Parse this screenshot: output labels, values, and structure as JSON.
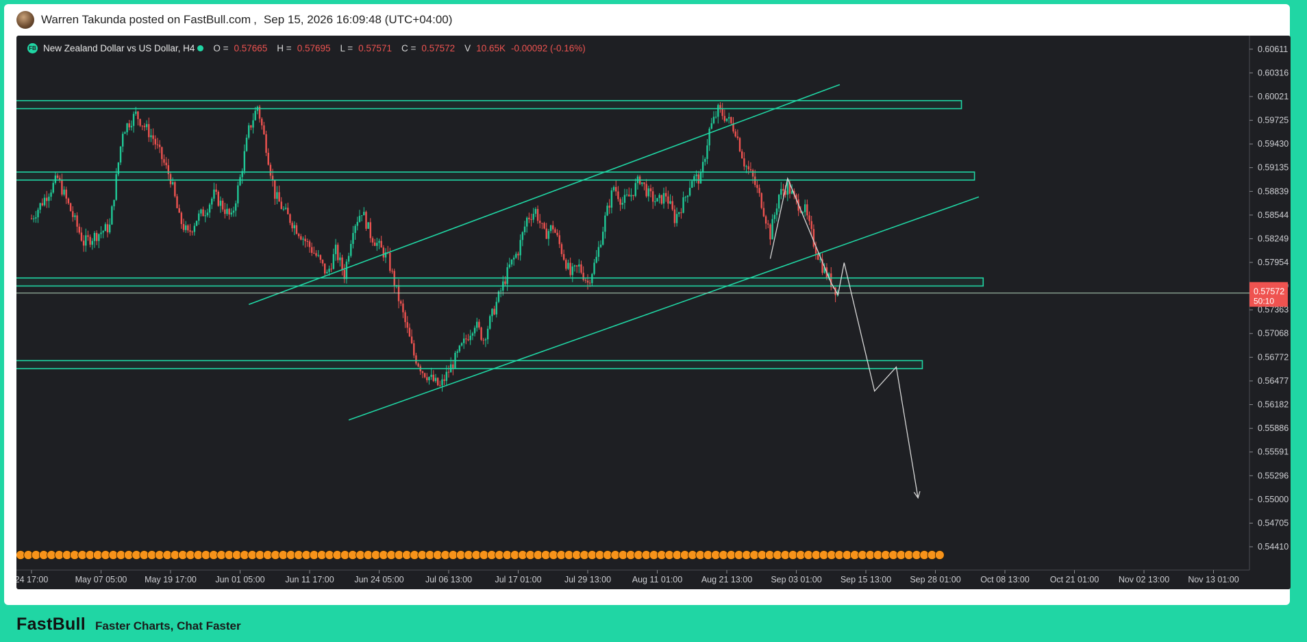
{
  "post": {
    "author_line": "Warren Takunda posted on FastBull.com",
    "separator": ",",
    "timestamp": "Sep 15, 2026 16:09:48 (UTC+04:00)"
  },
  "instrument": {
    "badge": "FB",
    "name": "New Zealand Dollar vs US Dollar, H4",
    "open_label": "O =",
    "open": "0.57665",
    "high_label": "H =",
    "high": "0.57695",
    "low_label": "L =",
    "low": "0.57571",
    "close_label": "C =",
    "close": "0.57572",
    "volume_label": "V",
    "volume": "10.65K",
    "change": "-0.00092 (-0.16%)"
  },
  "price_tag": {
    "price": "0.57572",
    "countdown": "50:10",
    "color": "#ef5350"
  },
  "footer": {
    "brand": "FastBull",
    "tagline": "Faster Charts, Chat Faster"
  },
  "colors": {
    "up": "#20c997",
    "down": "#ef5350",
    "drawing": "#20d6a4",
    "projection": "#d8d8d8",
    "event_marker": "#f7931a",
    "background": "#1e1f23"
  },
  "chart_data": {
    "type": "line",
    "subtype": "candlestick",
    "title": "",
    "xlabel": "",
    "ylabel": "",
    "ylim": [
      0.5412,
      0.6078
    ],
    "grid": false,
    "y_ticks": [
      "0.60611",
      "0.60316",
      "0.60021",
      "0.59725",
      "0.59430",
      "0.59135",
      "0.58839",
      "0.58544",
      "0.58249",
      "0.57954",
      "0.57659",
      "0.57363",
      "0.57068",
      "0.56772",
      "0.56477",
      "0.56182",
      "0.55886",
      "0.55591",
      "0.55296",
      "0.55000",
      "0.54705",
      "0.54410"
    ],
    "x_ticks": [
      "24 17:00",
      "May 07 05:00",
      "May 19 17:00",
      "Jun 01 05:00",
      "Jun 11 17:00",
      "Jun 24 05:00",
      "Jul 06 13:00",
      "Jul 17 01:00",
      "Jul 29 13:00",
      "Aug 11 01:00",
      "Aug 21 13:00",
      "Sep 03 01:00",
      "Sep 15 13:00",
      "Sep 28 01:00",
      "Oct 08 13:00",
      "Oct 21 01:00",
      "Nov 02 13:00",
      "Nov 13 01:00"
    ],
    "series": [
      {
        "values": [
          [
            0,
            0.585
          ],
          [
            3,
            0.59
          ],
          [
            6,
            0.582
          ],
          [
            9,
            0.584
          ],
          [
            10.5,
            0.596
          ],
          [
            12,
            0.598
          ],
          [
            14,
            0.595
          ],
          [
            16,
            0.59
          ],
          [
            17,
            0.585
          ],
          [
            18,
            0.583
          ],
          [
            19,
            0.585
          ],
          [
            20,
            0.586
          ],
          [
            21,
            0.588
          ],
          [
            23,
            0.585
          ],
          [
            24,
            0.59
          ],
          [
            25,
            0.596
          ],
          [
            26,
            0.599
          ],
          [
            27,
            0.594
          ],
          [
            28,
            0.588
          ],
          [
            29,
            0.586
          ],
          [
            31,
            0.583
          ],
          [
            33,
            0.58
          ],
          [
            34,
            0.578
          ],
          [
            35,
            0.581
          ],
          [
            36,
            0.578
          ],
          [
            37,
            0.584
          ],
          [
            38,
            0.586
          ],
          [
            39,
            0.583
          ],
          [
            41,
            0.58
          ],
          [
            42,
            0.576
          ],
          [
            43,
            0.572
          ],
          [
            44,
            0.568
          ],
          [
            45,
            0.566
          ],
          [
            46,
            0.565
          ],
          [
            47,
            0.564
          ],
          [
            48,
            0.566
          ],
          [
            49,
            0.568
          ],
          [
            50,
            0.57
          ],
          [
            51,
            0.572
          ],
          [
            52,
            0.57
          ],
          [
            53,
            0.573
          ],
          [
            54,
            0.576
          ],
          [
            55,
            0.579
          ],
          [
            56,
            0.581
          ],
          [
            57,
            0.585
          ],
          [
            58,
            0.586
          ],
          [
            59,
            0.583
          ],
          [
            60,
            0.584
          ],
          [
            61,
            0.581
          ],
          [
            62,
            0.578
          ],
          [
            63,
            0.579
          ],
          [
            64,
            0.577
          ],
          [
            65,
            0.58
          ],
          [
            66,
            0.585
          ],
          [
            67,
            0.589
          ],
          [
            68,
            0.587
          ],
          [
            69,
            0.588
          ],
          [
            70,
            0.59
          ],
          [
            71,
            0.588
          ],
          [
            72,
            0.587
          ],
          [
            73,
            0.588
          ],
          [
            74,
            0.585
          ],
          [
            75,
            0.587
          ],
          [
            76,
            0.59
          ],
          [
            77,
            0.59
          ],
          [
            78,
            0.596
          ],
          [
            79,
            0.5985
          ],
          [
            80,
            0.5975
          ],
          [
            81,
            0.596
          ],
          [
            82,
            0.592
          ],
          [
            83,
            0.59
          ],
          [
            84,
            0.587
          ],
          [
            85,
            0.583
          ],
          [
            86,
            0.588
          ],
          [
            87,
            0.589
          ],
          [
            88,
            0.587
          ],
          [
            89,
            0.586
          ],
          [
            90,
            0.582
          ],
          [
            91,
            0.579
          ],
          [
            92,
            0.577
          ],
          [
            92.8,
            0.57572
          ]
        ]
      }
    ],
    "projection": [
      [
        85,
        0.58
      ],
      [
        87,
        0.59
      ],
      [
        92,
        0.577
      ],
      [
        92.8,
        0.5755
      ],
      [
        93.5,
        0.5795
      ],
      [
        97,
        0.5635
      ],
      [
        99.5,
        0.5665
      ],
      [
        102,
        0.5502
      ]
    ],
    "zones": [
      {
        "low": 0.5987,
        "high": 0.5997,
        "x_end": 107
      },
      {
        "low": 0.5898,
        "high": 0.5908,
        "x_end": 108.5
      },
      {
        "low": 0.5766,
        "high": 0.5776,
        "x_end": 109.5
      },
      {
        "low": 0.5663,
        "high": 0.5673,
        "x_end": 102.5
      }
    ],
    "trendlines": [
      [
        [
          25,
          0.5743
        ],
        [
          93,
          0.6017
        ]
      ],
      [
        [
          36.5,
          0.5599
        ],
        [
          109,
          0.5877
        ]
      ]
    ],
    "current_price_line": 0.57572,
    "event_markers": {
      "count": 120,
      "x_end": 104.5
    }
  }
}
